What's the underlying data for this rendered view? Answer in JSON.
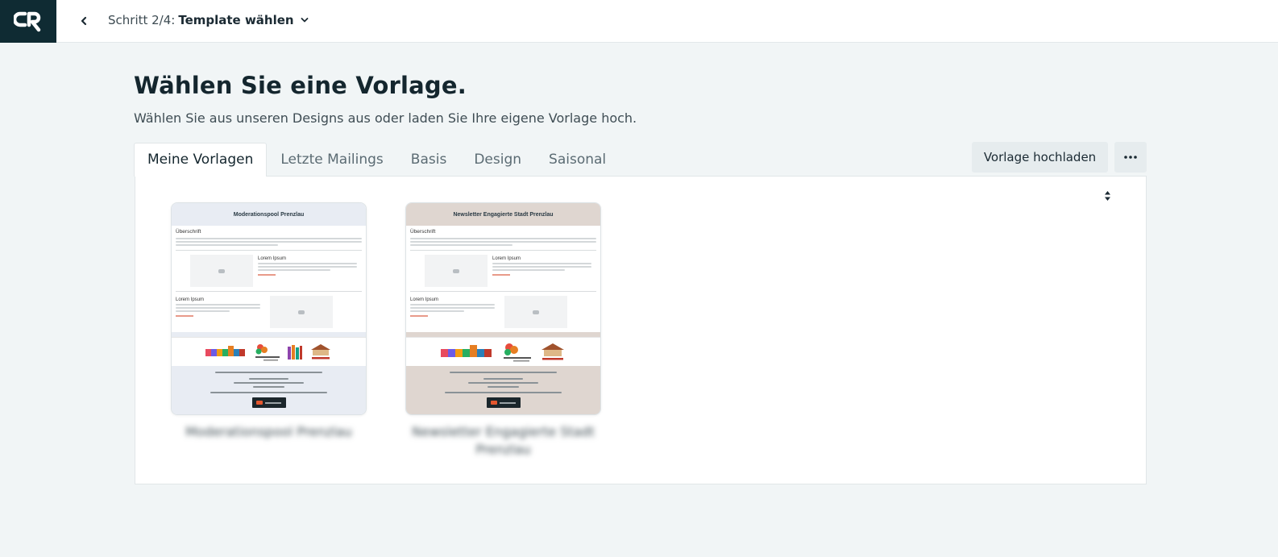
{
  "header": {
    "step_prefix": "Schritt 2/4:",
    "step_title": "Template wählen"
  },
  "page": {
    "title": "Wählen Sie eine Vorlage.",
    "subtitle": "Wählen Sie aus unseren Designs aus oder laden Sie Ihre eigene Vorlage hoch."
  },
  "tabs": [
    {
      "label": "Meine Vorlagen",
      "active": true
    },
    {
      "label": "Letzte Mailings",
      "active": false
    },
    {
      "label": "Basis",
      "active": false
    },
    {
      "label": "Design",
      "active": false
    },
    {
      "label": "Saisonal",
      "active": false
    }
  ],
  "toolbar": {
    "upload_label": "Vorlage hochladen"
  },
  "templates": [
    {
      "thumb_title": "Moderationspool Prenzlau",
      "heading": "Überschrift",
      "block1_title": "Lorem Ipsum",
      "block2_title": "Lorem Ipsum",
      "name": "Moderationspool Prenzlau",
      "header_color": "#e8ecf3",
      "footer_color": "#e8ecf3"
    },
    {
      "thumb_title": "Newsletter Engagierte Stadt Prenzlau",
      "heading": "Überschrift",
      "block1_title": "Lorem Ipsum",
      "block2_title": "Lorem Ipsum",
      "name": "Newsletter Engagierte Stadt Prenzlau",
      "header_color": "#dfd6d0",
      "footer_color": "#dfd6d0"
    }
  ],
  "colors": {
    "logo_bg": "#0f2b33",
    "page_bg": "#f1f5f6",
    "button_bg": "#e6ecee"
  }
}
